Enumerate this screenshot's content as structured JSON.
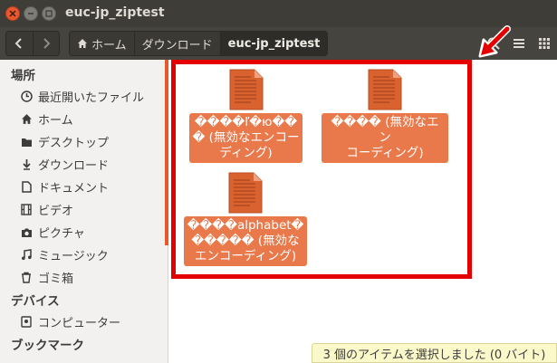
{
  "window": {
    "title": "euc-jp_ziptest"
  },
  "toolbar": {
    "breadcrumbs": [
      "ホーム",
      "ダウンロード",
      "euc-jp_ziptest"
    ]
  },
  "sidebar": {
    "places_header": "場所",
    "places": [
      {
        "label": "最近開いたファイル",
        "icon": "clock-icon"
      },
      {
        "label": "ホーム",
        "icon": "home-icon"
      },
      {
        "label": "デスクトップ",
        "icon": "folder-icon"
      },
      {
        "label": "ダウンロード",
        "icon": "download-icon"
      },
      {
        "label": "ドキュメント",
        "icon": "document-icon"
      },
      {
        "label": "ビデオ",
        "icon": "film-icon"
      },
      {
        "label": "ピクチャ",
        "icon": "camera-icon"
      },
      {
        "label": "ミュージック",
        "icon": "music-icon"
      },
      {
        "label": "ゴミ箱",
        "icon": "trash-icon"
      }
    ],
    "devices_header": "デバイス",
    "devices": [
      {
        "label": "コンピューター",
        "icon": "drive-icon"
      }
    ],
    "bookmarks_header": "ブックマーク"
  },
  "files": [
    {
      "line1": "����ľ�ю��",
      "line2": "� (無効なエンコー",
      "line3": "ディング)"
    },
    {
      "line1": "���� (無効なエン",
      "line2": "コーディング)"
    },
    {
      "line1": "����alphabet�",
      "line2": "����� (無効な",
      "line3": "エンコーディング)"
    }
  ],
  "status_bar": "3 個のアイテムを選択しました (0 バイト)",
  "colors": {
    "accent": "#e9794a",
    "annotation": "#e50000",
    "titlebar": "#3e3d38"
  }
}
